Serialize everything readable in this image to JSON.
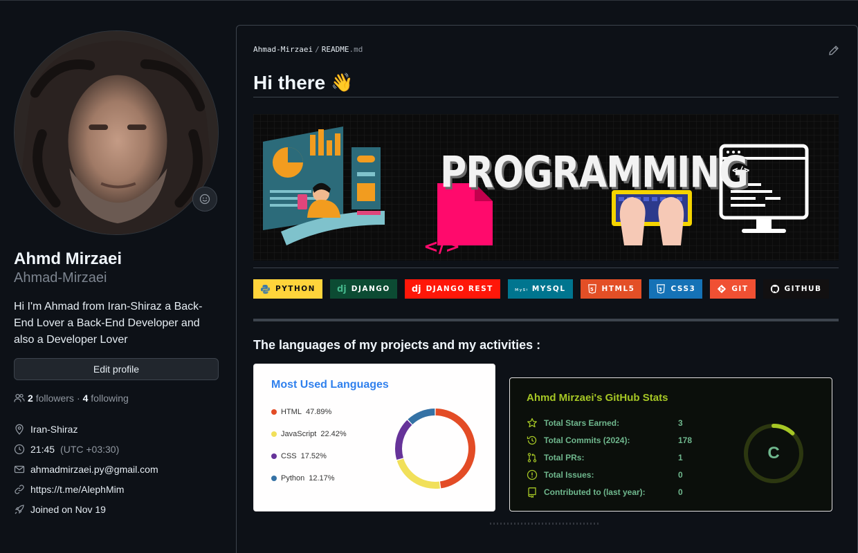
{
  "profile": {
    "name": "Ahmd Mirzaei",
    "login": "Ahmad-Mirzaei",
    "bio": "Hi I'm Ahmad from Iran-Shiraz a Back-End Lover a Back-End Developer and also a Developer Lover",
    "edit_label": "Edit profile",
    "followers_count": "2",
    "followers_label": "followers",
    "dot": "·",
    "following_count": "4",
    "following_label": "following",
    "location": "Iran-Shiraz",
    "time": "21:45",
    "timezone": "(UTC +03:30)",
    "email": "ahmadmirzaei.py@gmail.com",
    "link": "https://t.me/AlephMim",
    "joined": "Joined on Nov 19"
  },
  "readme": {
    "owner": "Ahmad-Mirzaei",
    "separator": "/",
    "file": "README",
    "ext": ".md",
    "heading": "Hi there",
    "heading_emoji": "👋",
    "banner_text": "PROGRAMMING",
    "banner_code_tag": "</>",
    "section_heading": "The languages of my projects and my activities :"
  },
  "badges": [
    {
      "label": "PYTHON",
      "bg": "#ffd43b",
      "fg": "#111111",
      "icon": "python-icon"
    },
    {
      "label": "DJANGO",
      "bg": "#0c4b33",
      "fg": "#ffffff",
      "icon": "django-icon",
      "glyph": "dj"
    },
    {
      "label": "DJANGO REST",
      "bg": "#ff1709",
      "fg": "#ffffff",
      "icon": "django-icon",
      "glyph": "dj"
    },
    {
      "label": "MYSQL",
      "bg": "#00758f",
      "fg": "#ffffff",
      "icon": "mysql-icon",
      "glyph": "MySQL"
    },
    {
      "label": "HTML5",
      "bg": "#e34f26",
      "fg": "#ffffff",
      "icon": "html5-icon",
      "glyph": "5"
    },
    {
      "label": "CSS3",
      "bg": "#1572b6",
      "fg": "#ffffff",
      "icon": "css3-icon",
      "glyph": "3"
    },
    {
      "label": "GIT",
      "bg": "#f05033",
      "fg": "#ffffff",
      "icon": "git-icon"
    },
    {
      "label": "GITHUB",
      "bg": "#121011",
      "fg": "#ffffff",
      "icon": "github-icon"
    }
  ],
  "languages_card": {
    "title": "Most Used Languages",
    "items": [
      {
        "name": "HTML",
        "percent": "47.89%",
        "value": 47.89,
        "color": "#e34c26"
      },
      {
        "name": "JavaScript",
        "percent": "22.42%",
        "value": 22.42,
        "color": "#f1e05a"
      },
      {
        "name": "CSS",
        "percent": "17.52%",
        "value": 17.52,
        "color": "#663399"
      },
      {
        "name": "Python",
        "percent": "12.17%",
        "value": 12.17,
        "color": "#3572a5"
      }
    ]
  },
  "stats_card": {
    "title": "Ahmd Mirzaei's GitHub Stats",
    "rows": [
      {
        "label": "Total Stars Earned:",
        "value": "3",
        "icon": "star-icon"
      },
      {
        "label": "Total Commits (2024):",
        "value": "178",
        "icon": "history-icon"
      },
      {
        "label": "Total PRs:",
        "value": "1",
        "icon": "pull-request-icon"
      },
      {
        "label": "Total Issues:",
        "value": "0",
        "icon": "issue-icon"
      },
      {
        "label": "Contributed to (last year):",
        "value": "0",
        "icon": "repo-icon"
      }
    ],
    "rank": "C",
    "rank_progress": 0.12,
    "colors": {
      "title": "#a6c725",
      "text": "#6fb78d",
      "ring": "#a6c725",
      "bg": "#0b0f0b"
    }
  }
}
